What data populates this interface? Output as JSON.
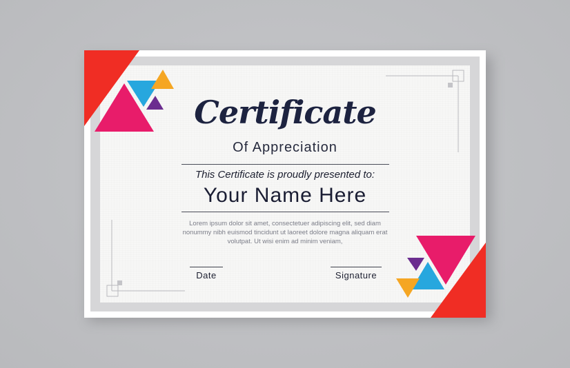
{
  "certificate": {
    "title": "Certificate",
    "subtitle": "Of Appreciation",
    "presented_line": "This Certificate is proudly presented to:",
    "recipient_name": "Your Name Here",
    "body_text": "Lorem ipsum dolor sit amet, consectetuer adipiscing elit, sed diam nonummy nibh euismod tincidunt ut laoreet dolore magna aliquam erat volutpat. Ut wisi enim ad minim veniam,",
    "date_label": "Date",
    "signature_label": "Signature"
  },
  "colors": {
    "background": "#bfc0c3",
    "card": "#ffffff",
    "frame_band": "#d6d6d8",
    "paper": "#f7f7f6",
    "text_dark": "#1d2340",
    "accent_red": "#f02d24",
    "accent_magenta": "#e81c6a",
    "accent_blue": "#27a7de",
    "accent_orange": "#f5a623",
    "accent_purple": "#6b2d8f"
  }
}
